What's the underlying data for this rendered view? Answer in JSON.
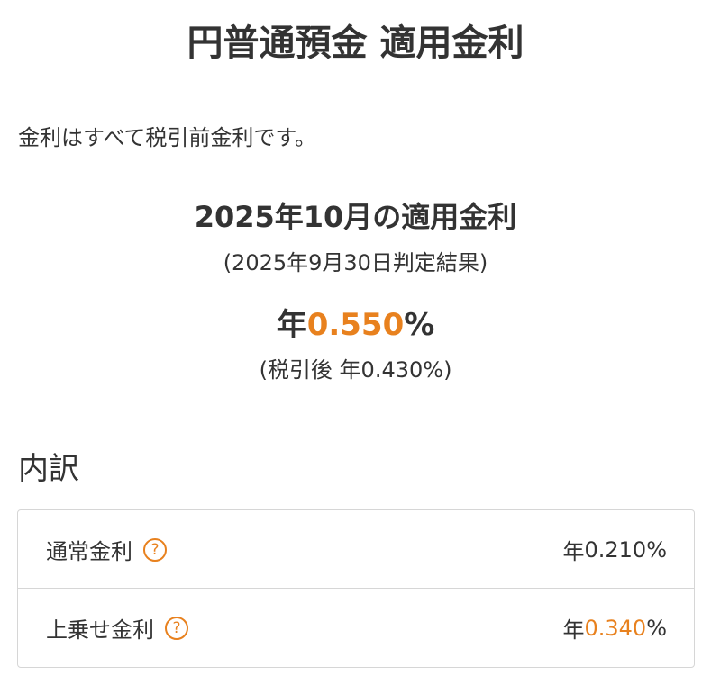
{
  "title": "円普通預金 適用金利",
  "note": "金利はすべて税引前金利です。",
  "rate": {
    "heading": "2025年10月の適用金利",
    "judgment_date": "(2025年9月30日判定結果)",
    "prefix": "年",
    "value": "0.550",
    "suffix": "%",
    "after_tax": "(税引後 年0.430%)"
  },
  "breakdown": {
    "heading": "内訳",
    "rows": [
      {
        "label": "通常金利",
        "help": "?",
        "prefix": "年",
        "value": "0.210",
        "suffix": "%"
      },
      {
        "label": "上乗せ金利",
        "help": "?",
        "prefix": "年",
        "value": "0.340",
        "suffix": "%"
      }
    ]
  },
  "colors": {
    "accent": "#e8811e",
    "text": "#333333",
    "border": "#d6d6d6"
  },
  "icons": {
    "help": "question-circle-icon"
  }
}
